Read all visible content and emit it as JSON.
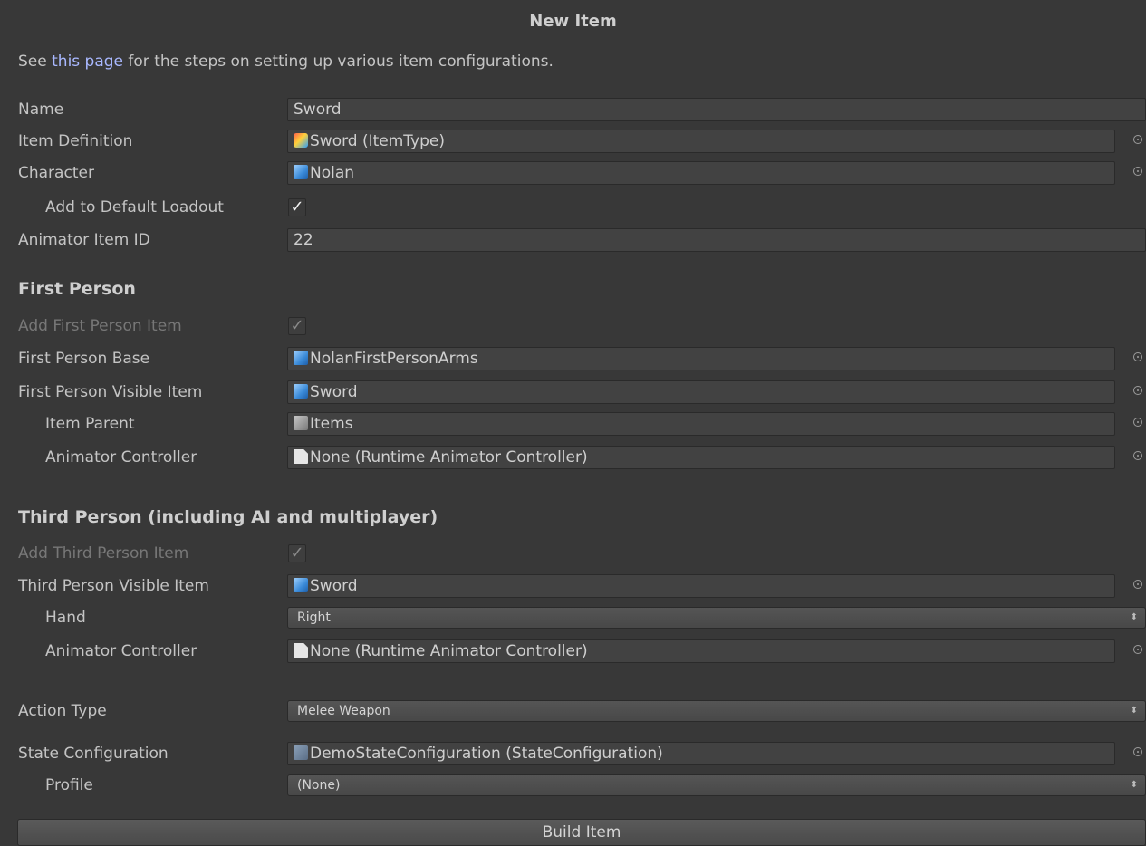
{
  "window": {
    "title": "New Item"
  },
  "info": {
    "prefix": "See ",
    "link": "this page",
    "suffix": " for the steps on setting up various item configurations."
  },
  "fields": {
    "name": {
      "label": "Name",
      "value": "Sword"
    },
    "item_definition": {
      "label": "Item Definition",
      "value": "Sword (ItemType)",
      "icon": "item-type-icon"
    },
    "character": {
      "label": "Character",
      "value": "Nolan",
      "icon": "prefab-icon"
    },
    "add_default_loadout": {
      "label": "Add to Default Loadout",
      "checked": true
    },
    "animator_item_id": {
      "label": "Animator Item ID",
      "value": "22"
    }
  },
  "first_person": {
    "header": "First Person",
    "add_item": {
      "label": "Add First Person Item",
      "checked": true
    },
    "base": {
      "label": "First Person Base",
      "value": "NolanFirstPersonArms",
      "icon": "prefab-icon"
    },
    "visible_item": {
      "label": "First Person Visible Item",
      "value": "Sword",
      "icon": "prefab-icon"
    },
    "item_parent": {
      "label": "Item Parent",
      "value": "Items",
      "icon": "gameobject-icon"
    },
    "animator_controller": {
      "label": "Animator Controller",
      "value": "None (Runtime Animator Controller)",
      "icon": "document-icon"
    }
  },
  "third_person": {
    "header": "Third Person (including AI and multiplayer)",
    "add_item": {
      "label": "Add Third Person Item",
      "checked": true
    },
    "visible_item": {
      "label": "Third Person Visible Item",
      "value": "Sword",
      "icon": "prefab-icon"
    },
    "hand": {
      "label": "Hand",
      "value": "Right"
    },
    "animator_controller": {
      "label": "Animator Controller",
      "value": "None (Runtime Animator Controller)",
      "icon": "document-icon"
    }
  },
  "action": {
    "label": "Action Type",
    "value": "Melee Weapon"
  },
  "state": {
    "configuration": {
      "label": "State Configuration",
      "value": "DemoStateConfiguration (StateConfiguration)",
      "icon": "asset-icon"
    },
    "profile": {
      "label": "Profile",
      "value": "(None)"
    }
  },
  "build_button": {
    "label": "Build Item"
  },
  "glyphs": {
    "check": "✓",
    "arrows": "⬍"
  }
}
